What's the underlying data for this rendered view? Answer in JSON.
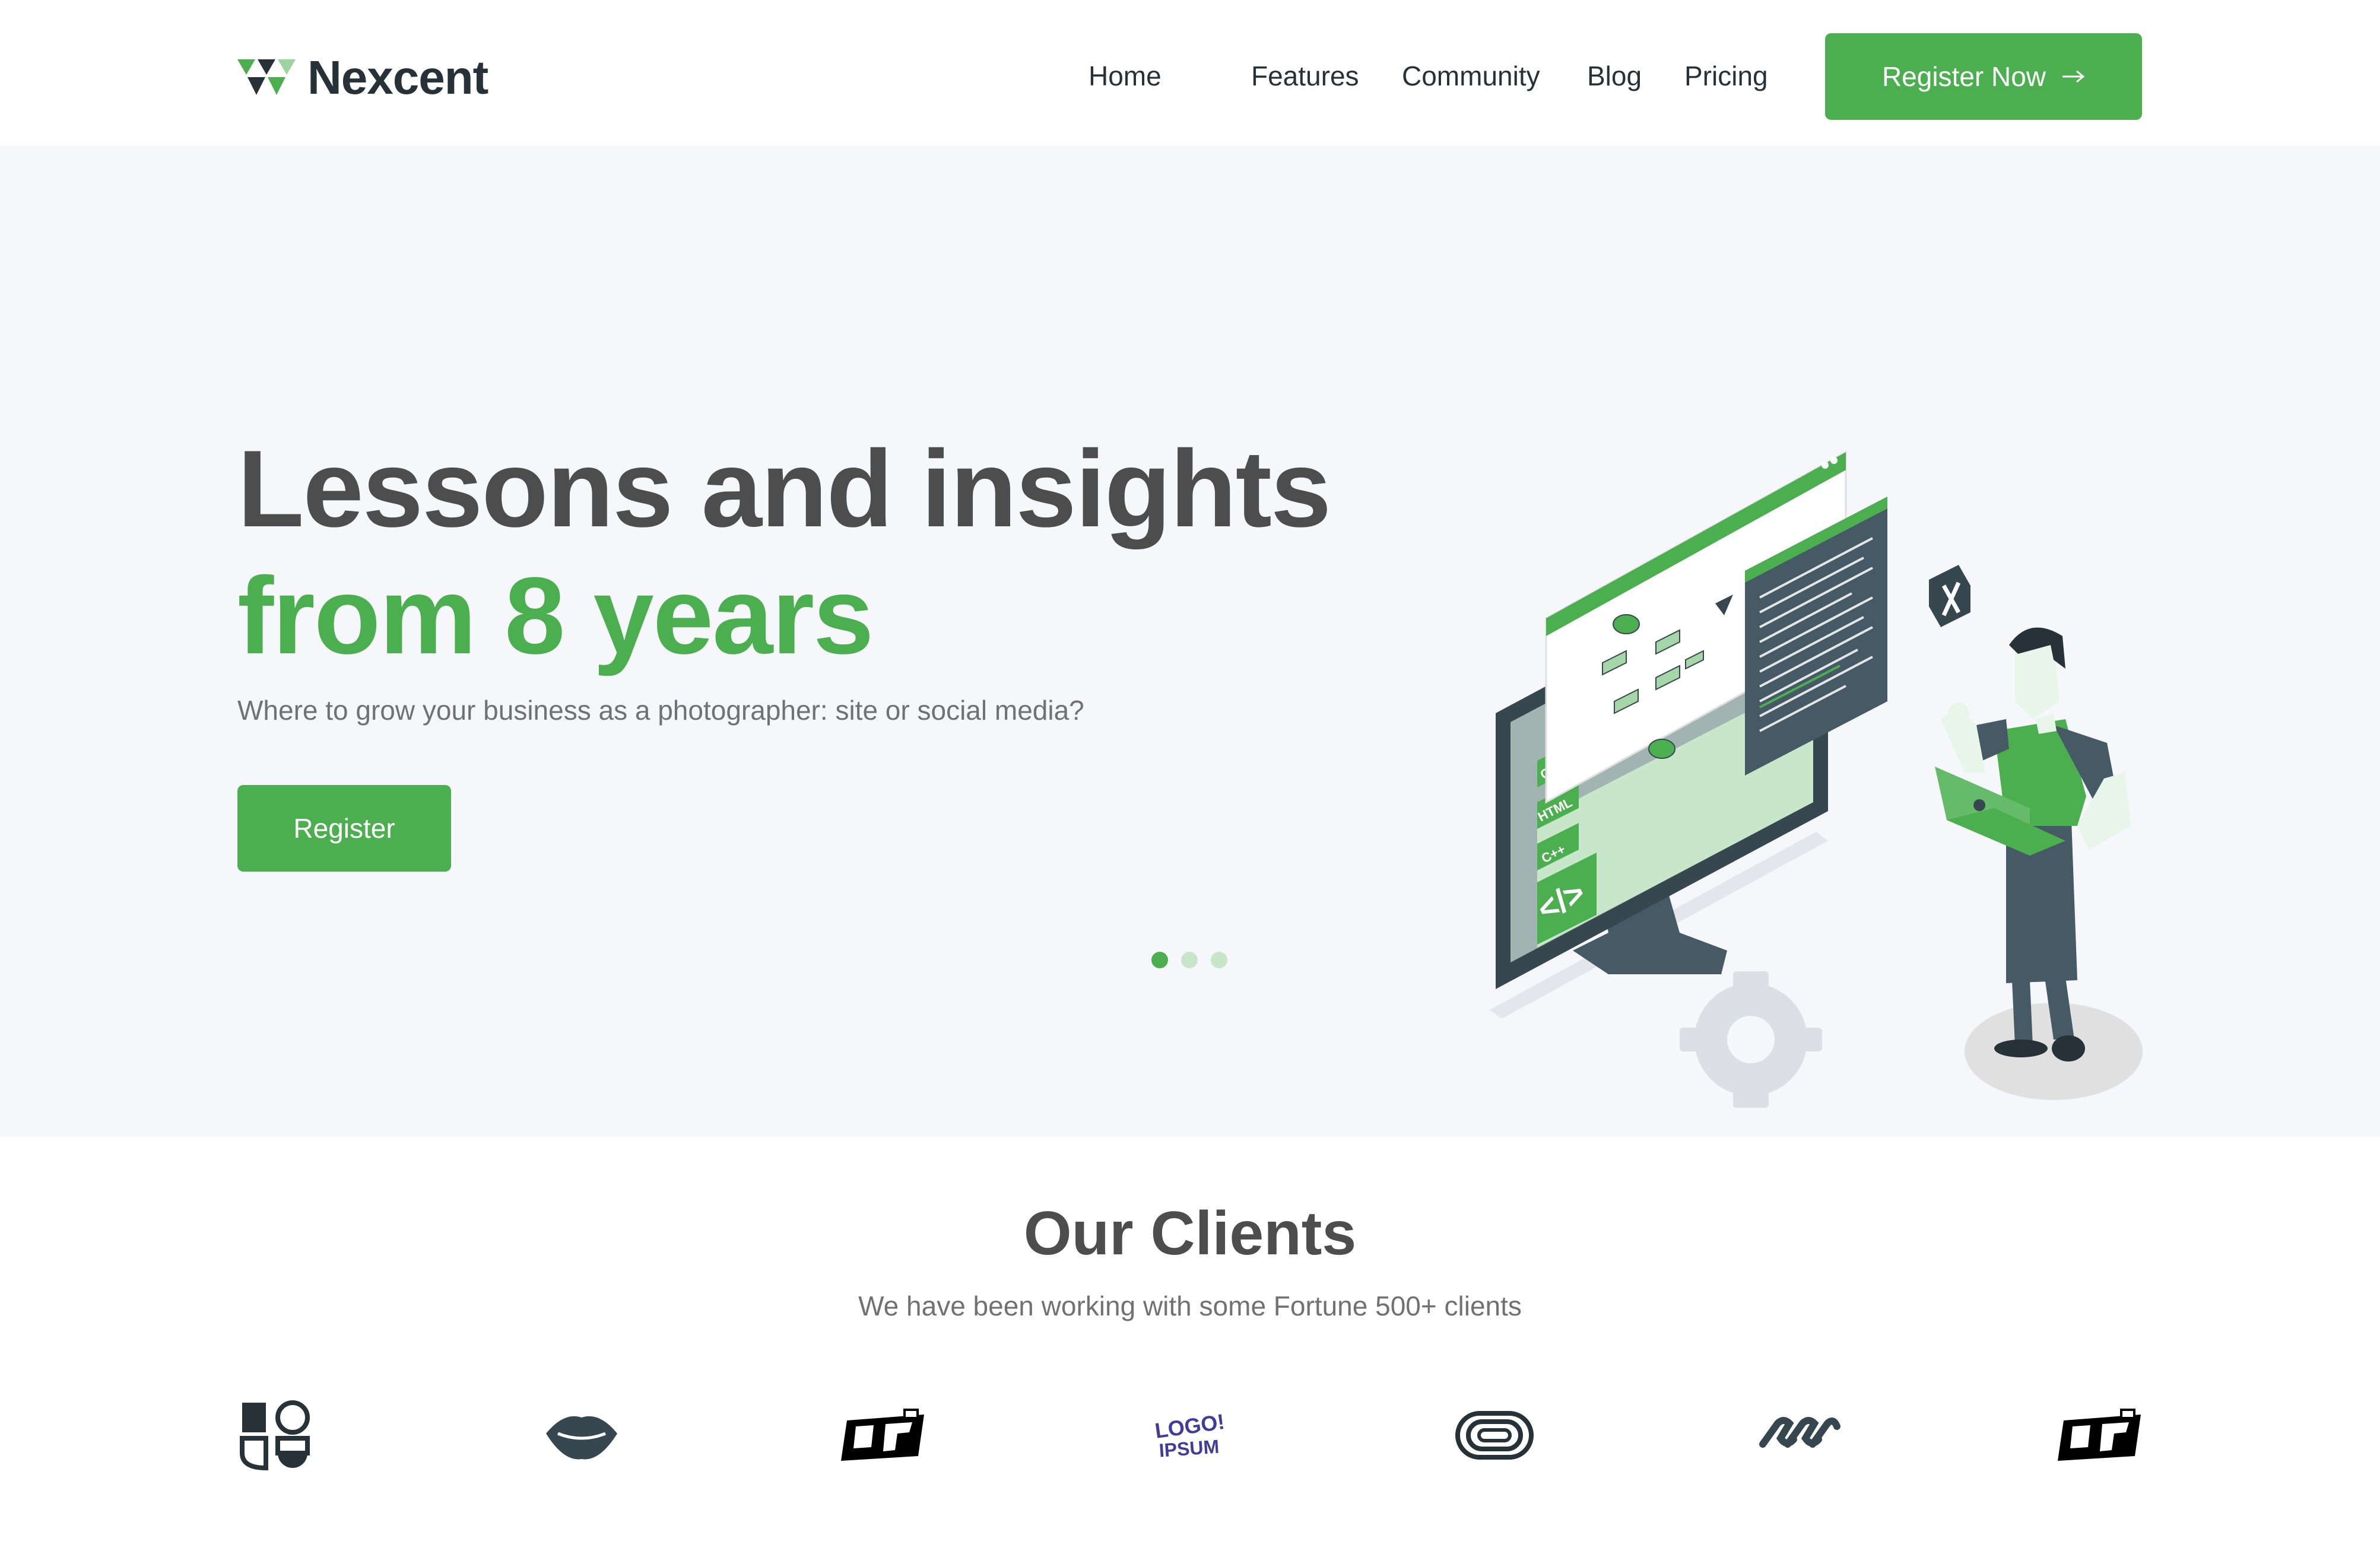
{
  "brand": {
    "name": "Nexcent",
    "logo_icon": "nexcent-triangle-logo-icon"
  },
  "nav": {
    "items": [
      {
        "label": "Home"
      },
      {
        "label": "Features"
      },
      {
        "label": "Community"
      },
      {
        "label": "Blog"
      },
      {
        "label": "Pricing"
      }
    ],
    "cta_label": "Register Now",
    "cta_icon": "arrow-right-icon"
  },
  "hero": {
    "title_line1": "Lessons and insights",
    "title_line2": "from 8 years",
    "subtitle": "Where to grow your business as a photographer: site or social media?",
    "button_label": "Register",
    "carousel": {
      "total": 3,
      "active_index": 0
    },
    "code_tags": [
      "CSS",
      "HTML",
      "C++"
    ]
  },
  "clients": {
    "title": "Our Clients",
    "subtitle": "We have been working with some Fortune 500+ clients",
    "logos": [
      {
        "name": "client-logo-1",
        "icon": "geometric-quad-logo-icon"
      },
      {
        "name": "client-logo-2",
        "icon": "lips-logo-icon"
      },
      {
        "name": "client-logo-3",
        "icon": "block-letters-logo-icon"
      },
      {
        "name": "client-logo-4",
        "icon": "logo-ipsum-wordmark-icon",
        "text_line1": "LOGO!",
        "text_line2": "IPSUM"
      },
      {
        "name": "client-logo-5",
        "icon": "concentric-loop-logo-icon"
      },
      {
        "name": "client-logo-6",
        "icon": "infinity-links-logo-icon"
      },
      {
        "name": "client-logo-7",
        "icon": "block-letters-logo-icon"
      }
    ]
  },
  "colors": {
    "primary": "#4CAF4F",
    "primary_light": "#C8E6C9",
    "dark": "#263238",
    "text": "#4D4D4D",
    "muted": "#717171",
    "hero_bg": "#F5F7FA"
  }
}
